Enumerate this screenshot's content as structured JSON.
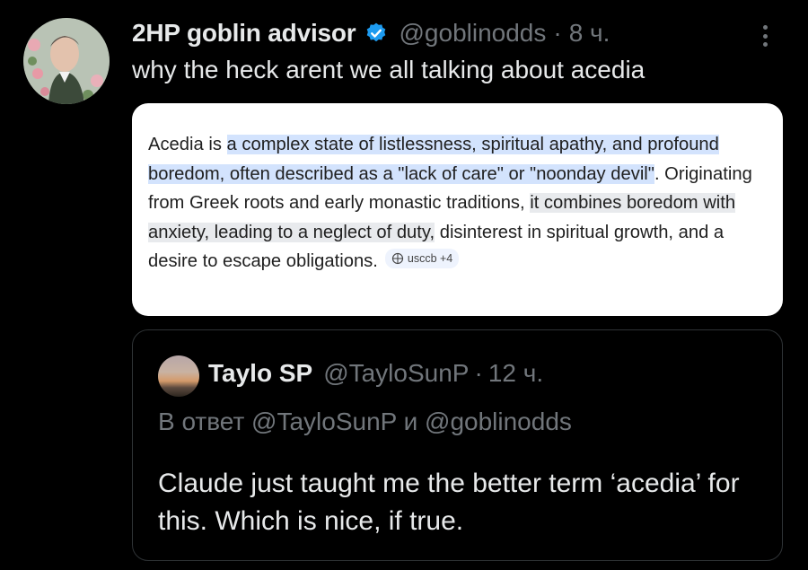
{
  "post": {
    "display_name": "2HP goblin advisor",
    "verified_icon": "verified-badge-icon",
    "handle": "@goblinodds",
    "separator": "·",
    "time": "8 ч.",
    "text": "why the heck arent we all talking about acedia",
    "more_icon": "more-options-icon"
  },
  "image": {
    "segments": [
      {
        "text": "Acedia is ",
        "style": "plain"
      },
      {
        "text": "a complex state of listlessness, spiritual apathy, and profound boredom, often described as a \"lack of care\" or \"noonday devil\"",
        "style": "blue"
      },
      {
        "text": ". Originating from Greek roots and early monastic traditions, ",
        "style": "plain"
      },
      {
        "text": "it combines boredom with anxiety, leading to a neglect of duty,",
        "style": "gray"
      },
      {
        "text": " disinterest in spiritual growth, and a desire to escape obligations.",
        "style": "plain"
      }
    ],
    "source_chip": "usccb +4",
    "source_icon": "globe-icon"
  },
  "quote": {
    "display_name": "Taylo SP",
    "handle": "@TayloSunP",
    "separator": "·",
    "time": "12 ч.",
    "reply_prefix": "В ответ",
    "reply_mention_1": "@TayloSunP",
    "reply_conjunction": "и",
    "reply_mention_2": "@goblinodds",
    "text": "Claude just taught me the better term ‘acedia’ for this. Which is nice, if true."
  },
  "colors": {
    "background": "#000000",
    "primary_text": "#e7e9ea",
    "secondary_text": "#71767b",
    "verified_blue": "#1d9bf0",
    "highlight_blue": "#d3e3fd",
    "highlight_gray": "#e8eaed"
  }
}
